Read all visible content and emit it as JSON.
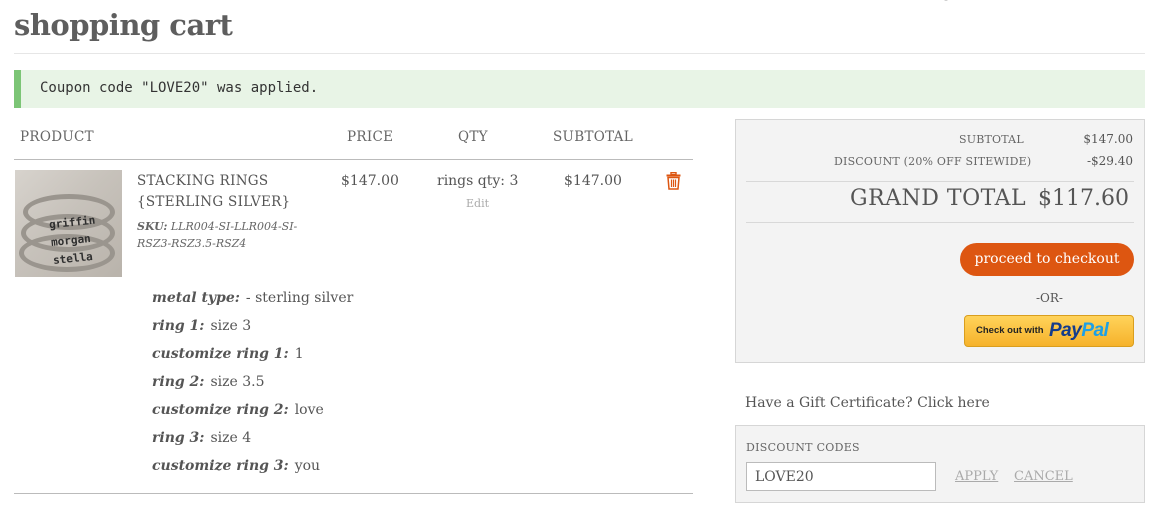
{
  "page": {
    "title": "shopping cart"
  },
  "notice": {
    "message": "Coupon code \"LOVE20\" was applied."
  },
  "cart": {
    "headers": {
      "product": "PRODUCT",
      "price": "PRICE",
      "qty": "QTY",
      "subtotal": "SUBTOTAL"
    },
    "item": {
      "name": "STACKING RINGS {STERLING SILVER}",
      "sku_label": "SKU:",
      "sku_value": "LLR004-SI-LLR004-SI-RSZ3-RSZ3.5-RSZ4",
      "price": "$147.00",
      "qty": "rings qty: 3",
      "edit_label": "Edit",
      "subtotal": "$147.00",
      "thumb_words": [
        "griffin",
        "morgan",
        "stella"
      ],
      "delete_icon": "trash-icon",
      "options": [
        {
          "label": "metal type:",
          "value": "- sterling silver"
        },
        {
          "label": "ring 1:",
          "value": "size 3"
        },
        {
          "label": "customize ring 1:",
          "value": "1"
        },
        {
          "label": "ring 2:",
          "value": "size 3.5"
        },
        {
          "label": "customize ring 2:",
          "value": "love"
        },
        {
          "label": "ring 3:",
          "value": "size 4"
        },
        {
          "label": "customize ring 3:",
          "value": "you"
        }
      ]
    }
  },
  "summary": {
    "subtotal_label": "SUBTOTAL",
    "subtotal_value": "$147.00",
    "discount_label": "DISCOUNT (20% OFF SITEWIDE)",
    "discount_value": "-$29.40",
    "grand_total_label": "GRAND TOTAL",
    "grand_total_value": "$117.60",
    "checkout_label": "proceed to checkout",
    "or_label": "-OR-",
    "paypal_prefix": "Check out with",
    "paypal_pay": "Pay",
    "paypal_pal": "Pal"
  },
  "gift": {
    "label": "Have a Gift Certificate? Click here"
  },
  "discount_codes": {
    "label": "DISCOUNT CODES",
    "value": "LOVE20",
    "apply_label": "APPLY",
    "cancel_label": "CANCEL"
  },
  "colors": {
    "accent": "#dd5611",
    "notice_bg": "#e8f4e6",
    "notice_border": "#7cc576",
    "paypal_yellow": "#ffc439"
  }
}
